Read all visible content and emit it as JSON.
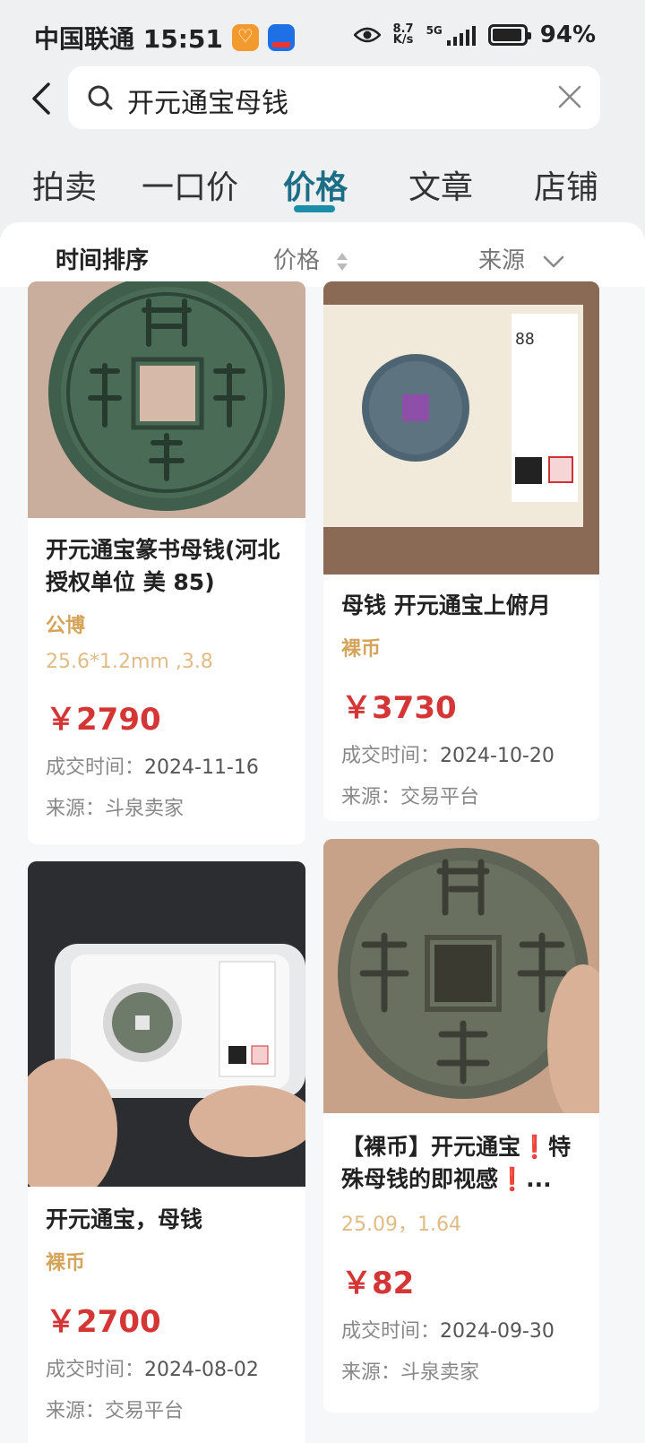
{
  "status_bar": {
    "carrier_time": "中国联通 15:51",
    "net_speed_value": "8.7",
    "net_speed_unit": "K/s",
    "network": "5G",
    "battery": "94%",
    "battery_level": 0.94
  },
  "search": {
    "query": "开元通宝母钱"
  },
  "tabs": [
    {
      "label": "拍卖"
    },
    {
      "label": "一口价"
    },
    {
      "label": "价格"
    },
    {
      "label": "文章"
    },
    {
      "label": "店铺"
    }
  ],
  "active_tab": "价格",
  "sort_bar": {
    "time_sort": "时间排序",
    "price": "价格",
    "source": "来源"
  },
  "labels": {
    "deal_time": "成交时间：",
    "source": "来源："
  },
  "items": [
    {
      "title": "开元通宝篆书母钱(河北授权单位 美 85)",
      "tag": "公博",
      "spec": "25.6*1.2mm ,3.8",
      "price": "￥2790",
      "deal_time": "2024-11-16",
      "source": "斗泉卖家",
      "image": "coin-photo"
    },
    {
      "title": "母钱 开元通宝上俯月",
      "tag": "裸币",
      "spec": "",
      "price": "￥3730",
      "deal_time": "2024-10-20",
      "source": "交易平台",
      "image": "coin-in-graded-holder"
    },
    {
      "title": "开元通宝，母钱",
      "tag": "裸币",
      "spec": "",
      "price": "￥2700",
      "deal_time": "2024-08-02",
      "source": "交易平台",
      "image": "coin-in-slab"
    },
    {
      "title": "【裸币】开元通宝❗特殊母钱的即视感❗...",
      "tag": "",
      "spec": "25.09，1.64",
      "price": "￥82",
      "deal_time": "2024-09-30",
      "source": "斗泉卖家",
      "image": "coin-photo"
    }
  ],
  "colors": {
    "accent": "#1c6e86",
    "tab_underline": "#1c8ea8",
    "price": "#d43535",
    "tag": "#d4a45a",
    "spec": "#e0bb86"
  }
}
